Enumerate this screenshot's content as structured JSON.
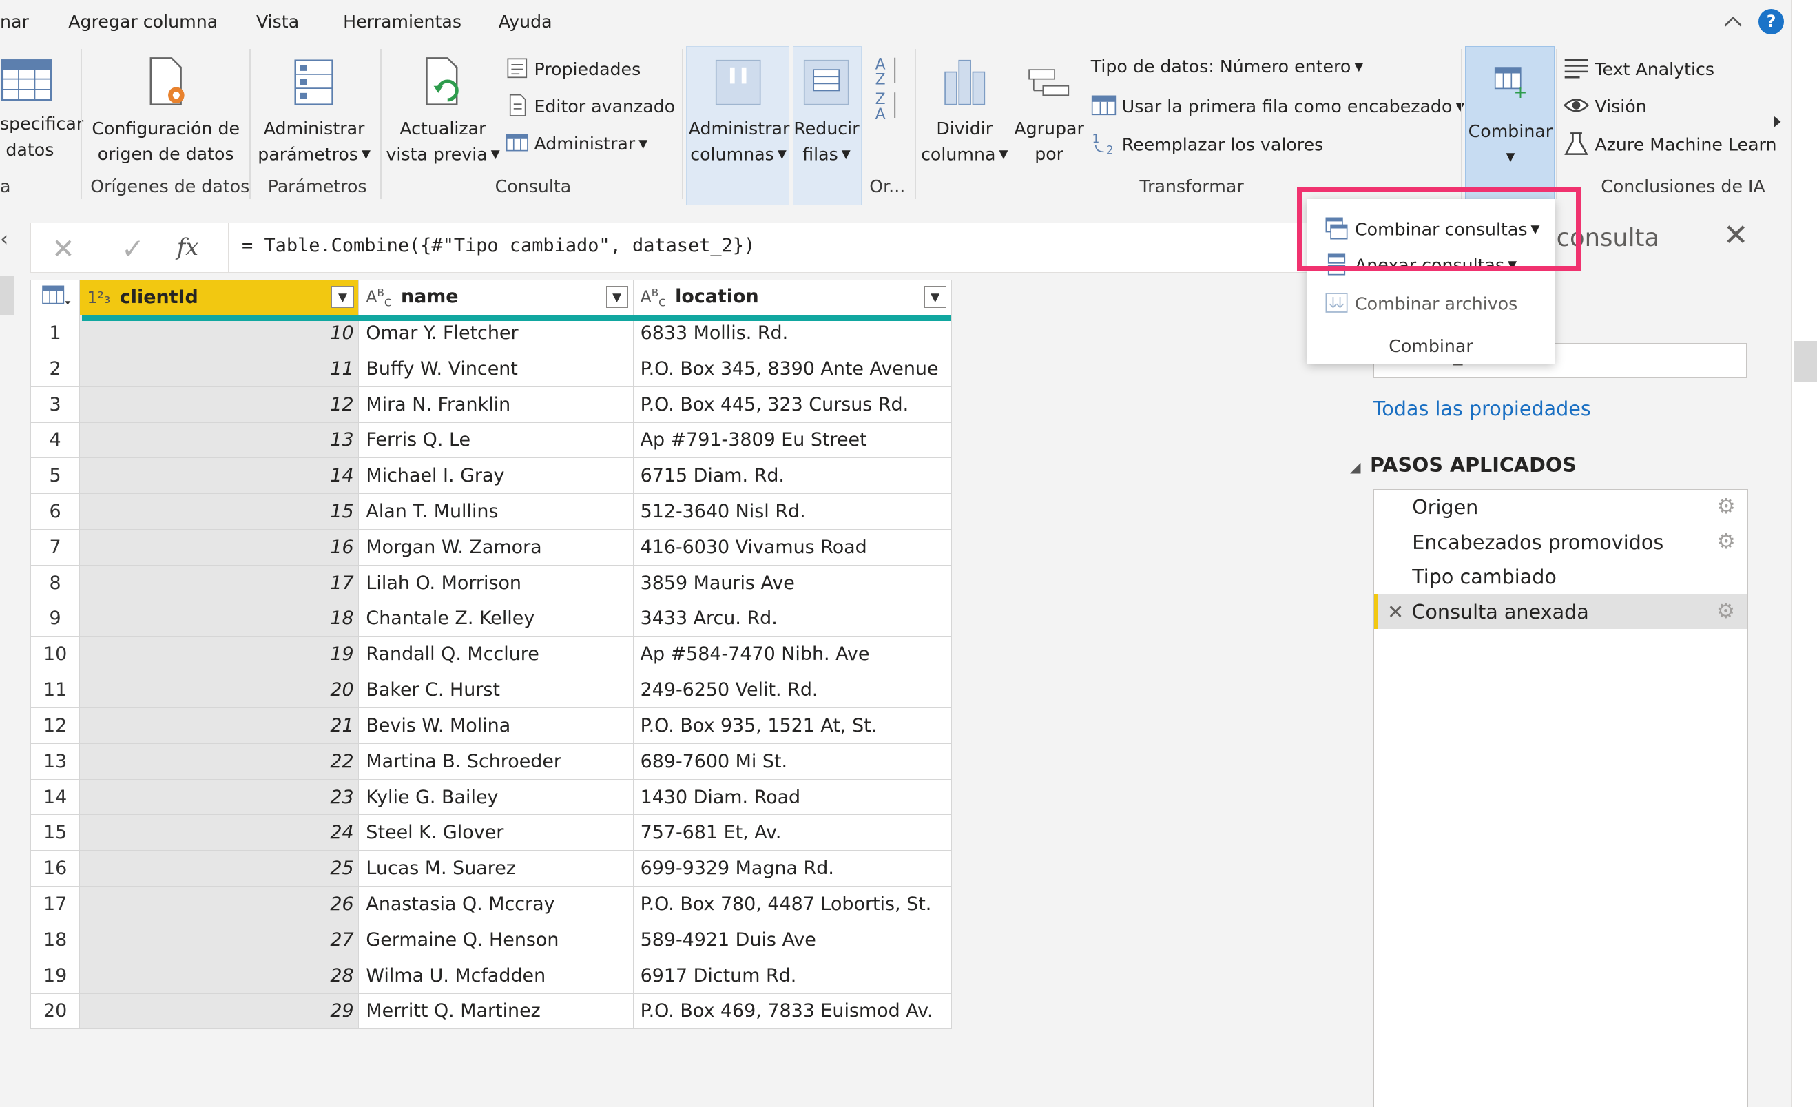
{
  "menu": {
    "items": [
      "nar",
      "Agregar columna",
      "Vista",
      "Herramientas",
      "Ayuda"
    ],
    "help": "?"
  },
  "ribbon": {
    "especificar": [
      "specificar",
      "datos"
    ],
    "configuracion": [
      "Configuración de",
      "origen de datos"
    ],
    "administrar_params": [
      "Administrar",
      "parámetros"
    ],
    "actualizar": [
      "Actualizar",
      "vista previa"
    ],
    "propiedades": "Propiedades",
    "editor": "Editor avanzado",
    "administrar": "Administrar",
    "admin_columnas": [
      "Administrar",
      "columnas"
    ],
    "reducir_filas": [
      "Reducir",
      "filas"
    ],
    "dividir": [
      "Dividir",
      "columna"
    ],
    "agrupar": [
      "Agrupar",
      "por"
    ],
    "tipo_datos": "Tipo de datos: Número entero",
    "primera_fila": "Usar la primera fila como encabezado",
    "reemplazar": "Reemplazar los valores",
    "combinar": "Combinar",
    "text_analytics": "Text Analytics",
    "vision": "Visión",
    "azure": "Azure Machine Learn",
    "groups": {
      "left": "a",
      "origenes": "Orígenes de datos",
      "parametros": "Parámetros",
      "consulta": "Consulta",
      "ordenar": "Or...",
      "transformar": "Transformar",
      "conclusiones": "Conclusiones de IA"
    }
  },
  "formula": {
    "cancel": "✕",
    "confirm": "✓",
    "fx": "fx",
    "text": "= Table.Combine({#\"Tipo cambiado\", dataset_2})"
  },
  "table": {
    "columns": [
      {
        "type": "1²₃",
        "name": "clientId"
      },
      {
        "type": "A^B_C",
        "name": "name"
      },
      {
        "type": "A^B_C",
        "name": "location"
      }
    ],
    "rows": [
      {
        "n": "1",
        "id": "10",
        "name": "Omar Y. Fletcher",
        "location": "6833 Mollis. Rd."
      },
      {
        "n": "2",
        "id": "11",
        "name": "Buffy W. Vincent",
        "location": "P.O. Box 345, 8390 Ante Avenue"
      },
      {
        "n": "3",
        "id": "12",
        "name": "Mira N. Franklin",
        "location": "P.O. Box 445, 323 Cursus Rd."
      },
      {
        "n": "4",
        "id": "13",
        "name": "Ferris Q. Le",
        "location": "Ap #791-3809 Eu Street"
      },
      {
        "n": "5",
        "id": "14",
        "name": "Michael I. Gray",
        "location": "6715 Diam. Rd."
      },
      {
        "n": "6",
        "id": "15",
        "name": "Alan T. Mullins",
        "location": "512-3640 Nisl Rd."
      },
      {
        "n": "7",
        "id": "16",
        "name": "Morgan W. Zamora",
        "location": "416-6030 Vivamus Road"
      },
      {
        "n": "8",
        "id": "17",
        "name": "Lilah O. Morrison",
        "location": "3859 Mauris Ave"
      },
      {
        "n": "9",
        "id": "18",
        "name": "Chantale Z. Kelley",
        "location": "3433 Arcu. Rd."
      },
      {
        "n": "10",
        "id": "19",
        "name": "Randall Q. Mcclure",
        "location": "Ap #584-7470 Nibh. Ave"
      },
      {
        "n": "11",
        "id": "20",
        "name": "Baker C. Hurst",
        "location": "249-6250 Velit. Rd."
      },
      {
        "n": "12",
        "id": "21",
        "name": "Bevis W. Molina",
        "location": "P.O. Box 935, 1521 At, St."
      },
      {
        "n": "13",
        "id": "22",
        "name": "Martina B. Schroeder",
        "location": "689-7600 Mi St."
      },
      {
        "n": "14",
        "id": "23",
        "name": "Kylie G. Bailey",
        "location": "1430 Diam. Road"
      },
      {
        "n": "15",
        "id": "24",
        "name": "Steel K. Glover",
        "location": "757-681 Et, Av."
      },
      {
        "n": "16",
        "id": "25",
        "name": "Lucas M. Suarez",
        "location": "699-9329 Magna Rd."
      },
      {
        "n": "17",
        "id": "26",
        "name": "Anastasia Q. Mccray",
        "location": "P.O. Box 780, 4487 Lobortis, St."
      },
      {
        "n": "18",
        "id": "27",
        "name": "Germaine Q. Henson",
        "location": "589-4921 Duis Ave"
      },
      {
        "n": "19",
        "id": "28",
        "name": "Wilma U. Mcfadden",
        "location": "6917 Dictum Rd."
      },
      {
        "n": "20",
        "id": "29",
        "name": "Merritt Q. Martinez",
        "location": "P.O. Box 469, 7833 Euismod Av."
      }
    ]
  },
  "pane": {
    "title_partial": "consulta",
    "name_value": "dataset_1",
    "all_props": "Todas las propiedades",
    "steps_header": "PASOS APLICADOS",
    "steps": [
      "Origen",
      "Encabezados promovidos",
      "Tipo cambiado",
      "Consulta anexada"
    ]
  },
  "dropdown": {
    "combinar_consultas": "Combinar consultas",
    "anexar_consultas": "Anexar consultas",
    "combinar_archivos": "Combinar archivos",
    "footer": "Combinar"
  },
  "colors": {
    "accent_yellow": "#f2c811",
    "teal": "#11a7a0",
    "highlight_pink": "#f0326f",
    "link_blue": "#1a6fc2"
  }
}
